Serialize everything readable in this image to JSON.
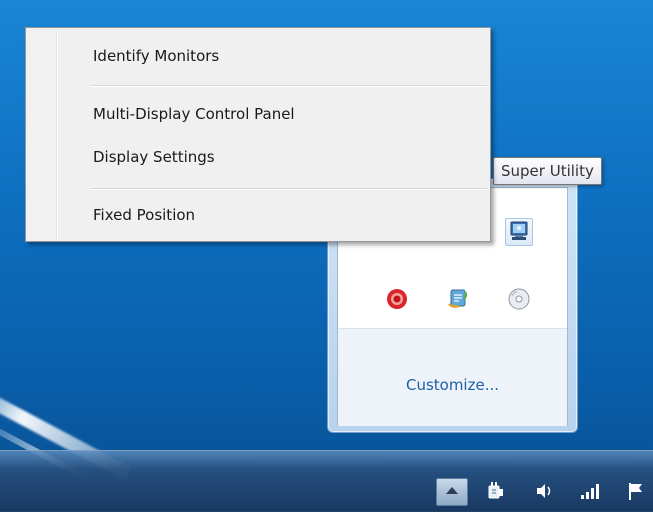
{
  "context_menu": {
    "items": [
      {
        "label": "Identify Monitors"
      },
      {
        "label": "Multi-Display Control Panel"
      },
      {
        "label": "Display Settings"
      },
      {
        "label": "Fixed Position"
      }
    ]
  },
  "tooltip": {
    "text": "Super Utility"
  },
  "tray_flyout": {
    "customize_label": "Customize...",
    "icons": [
      "super-utility-icon",
      "red-circle-app-icon",
      "update-globe-icon",
      "disc-drive-icon"
    ]
  },
  "taskbar": {
    "icons": [
      "show-hidden-icons-arrow",
      "power-plug-icon",
      "volume-icon",
      "network-signal-icon",
      "action-center-flag-icon"
    ]
  },
  "colors": {
    "desktop": "#0d6fc0",
    "link": "#1e5fa8",
    "menu_bg": "#f0f0f0"
  }
}
